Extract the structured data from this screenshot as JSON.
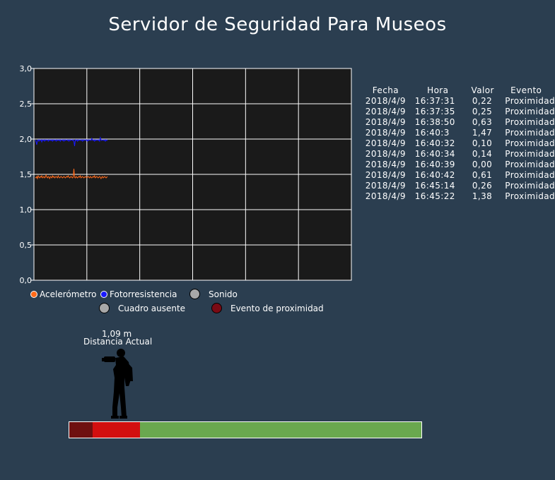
{
  "header": {
    "title": "Servidor de Seguridad Para Museos"
  },
  "chart_data": {
    "type": "line",
    "y_ticks": [
      "3,0",
      "2,5",
      "2,0",
      "1,5",
      "1,0",
      "0,5",
      "0,0"
    ],
    "ylim": [
      0,
      3
    ],
    "x_divisions": 6,
    "grid": true,
    "background": "#1a1a1a",
    "legend_position": "bottom",
    "series": [
      {
        "name": "Acelerómetro",
        "color": "#ff6a1a",
        "values": [
          1.46,
          1.45,
          1.47,
          1.44,
          1.48,
          1.46,
          1.45,
          1.47,
          1.46,
          1.48,
          1.45,
          1.46,
          1.47,
          1.45,
          1.46,
          1.49,
          1.46,
          1.45,
          1.47,
          1.46,
          1.44,
          1.47,
          1.46,
          1.45,
          1.48,
          1.46,
          1.47,
          1.45,
          1.46,
          1.47,
          1.46,
          1.45,
          1.48,
          1.46,
          1.45,
          1.46,
          1.47,
          1.46,
          1.45,
          1.46,
          1.47,
          1.46,
          1.45,
          1.46,
          1.47,
          1.46,
          1.48,
          1.46,
          1.45,
          1.46,
          1.47,
          1.46,
          1.45,
          1.46,
          1.58,
          1.46,
          1.45,
          1.47,
          1.46,
          1.45,
          1.46,
          1.47,
          1.46,
          1.48,
          1.45,
          1.46,
          1.47,
          1.46,
          1.45,
          1.46,
          1.47,
          1.46,
          1.45,
          1.46,
          1.47,
          1.46,
          1.45,
          1.47,
          1.46,
          1.45,
          1.46,
          1.47,
          1.46,
          1.48,
          1.45,
          1.46,
          1.47,
          1.46,
          1.45,
          1.46,
          1.47,
          1.46,
          1.44,
          1.46,
          1.47,
          1.45,
          1.46,
          1.47,
          1.46,
          1.45,
          1.46,
          1.47
        ]
      },
      {
        "name": "Fotorresistencia",
        "color": "#1a1aff",
        "values": [
          1.99,
          1.96,
          1.92,
          1.98,
          1.99,
          1.97,
          1.99,
          1.98,
          1.99,
          1.96,
          1.99,
          1.98,
          1.99,
          1.97,
          1.99,
          1.98,
          1.99,
          1.99,
          1.97,
          1.99,
          1.98,
          1.99,
          1.98,
          1.99,
          1.97,
          1.99,
          1.98,
          1.99,
          1.99,
          1.97,
          1.99,
          1.98,
          1.99,
          1.98,
          1.99,
          1.97,
          1.99,
          1.99,
          1.98,
          1.99,
          1.97,
          1.99,
          1.98,
          1.99,
          1.99,
          1.98,
          1.99,
          1.97,
          1.99,
          1.98,
          1.99,
          1.99,
          1.98,
          1.99,
          1.97,
          1.9,
          1.99,
          1.98,
          1.99,
          1.97,
          1.99,
          1.98,
          1.99,
          1.99,
          1.98,
          1.99,
          1.97,
          1.99,
          1.98,
          1.99,
          1.99,
          1.98,
          1.99,
          1.97,
          1.99,
          1.98,
          1.99,
          1.99,
          1.98,
          2.01,
          1.99,
          1.98,
          1.99,
          1.97,
          1.99,
          1.98,
          1.99,
          1.99,
          1.98,
          1.99,
          1.97,
          2.02,
          1.99,
          1.98,
          1.99,
          1.99,
          1.98,
          1.99,
          1.97,
          1.99,
          1.98,
          1.99
        ]
      }
    ]
  },
  "legend": {
    "row1": [
      {
        "label": "Acelerómetro",
        "color": "#ff6a1a",
        "size": "small"
      },
      {
        "label": "Fotorresistencia",
        "color": "#1a1aff",
        "size": "small"
      },
      {
        "label": "Sonido",
        "color": "#a8a8a8",
        "size": "big"
      }
    ],
    "row2": [
      {
        "label": "Cuadro ausente",
        "color": "#a8a8a8",
        "size": "big"
      },
      {
        "label": "Evento de proximidad",
        "color": "#7a0a14",
        "size": "big"
      }
    ]
  },
  "events_table": {
    "headers": [
      "Fecha",
      "Hora",
      "Valor",
      "Evento"
    ],
    "rows": [
      [
        "2018/4/9",
        "16:37:31",
        "0,22",
        "Proximidad"
      ],
      [
        "2018/4/9",
        "16:37:35",
        "0,25",
        "Proximidad"
      ],
      [
        "2018/4/9",
        "16:38:50",
        "0,63",
        "Proximidad"
      ],
      [
        "2018/4/9",
        "16:40:3",
        "1,47",
        "Proximidad"
      ],
      [
        "2018/4/9",
        "16:40:32",
        "0,10",
        "Proximidad"
      ],
      [
        "2018/4/9",
        "16:40:34",
        "0,14",
        "Proximidad"
      ],
      [
        "2018/4/9",
        "16:40:39",
        "0,00",
        "Proximidad"
      ],
      [
        "2018/4/9",
        "16:40:42",
        "0,61",
        "Proximidad"
      ],
      [
        "2018/4/9",
        "16:45:14",
        "0,26",
        "Proximidad"
      ],
      [
        "2018/4/9",
        "16:45:22",
        "1,38",
        "Proximidad"
      ]
    ]
  },
  "distance": {
    "value": "1,09 m",
    "label": "Distancia Actual",
    "icon": "person-camera-icon"
  },
  "distance_bar": {
    "segments": [
      {
        "name": "dark-red-zone",
        "color": "#6e1010",
        "fraction": 0.066
      },
      {
        "name": "red-zone",
        "color": "#d20f0f",
        "fraction": 0.134
      },
      {
        "name": "green-zone",
        "color": "#6aa84f",
        "fraction": 0.8
      }
    ]
  }
}
